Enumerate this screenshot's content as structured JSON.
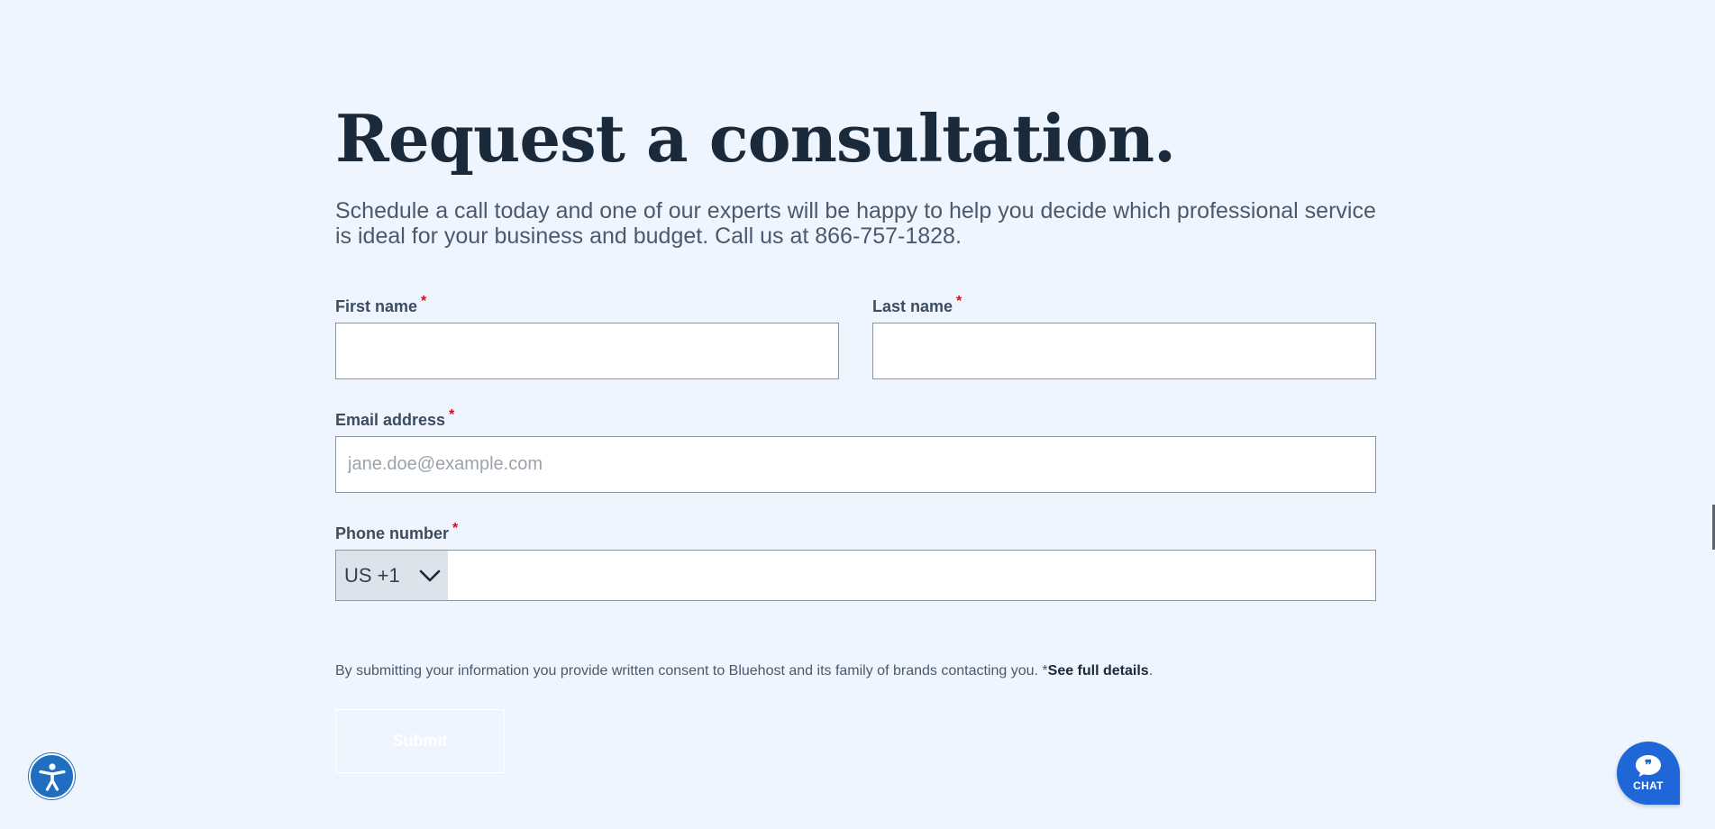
{
  "header": {
    "title": "Request a consultation.",
    "subtitle": "Schedule a call today and one of our experts will be happy to help you decide which professional service is ideal for your business and budget. Call us at 866-757-1828."
  },
  "form": {
    "first_name_label": "First name",
    "last_name_label": "Last name",
    "email_label": "Email address",
    "email_placeholder": "jane.doe@example.com",
    "phone_label": "Phone number",
    "country_code": "US +1",
    "required_marker": "*",
    "consent_text": "By submitting your information you provide written consent to Bluehost and its family of brands contacting you. *",
    "consent_link": "See full details",
    "consent_end": ".",
    "submit_label": "Submit"
  },
  "widgets": {
    "chat_label": "CHAT",
    "accessibility_icon": "accessibility-icon",
    "chat_icon": "chat-bubble-icon"
  },
  "colors": {
    "background": "#eef5ff",
    "heading": "#1b2a3b",
    "required": "#c4161c",
    "accent": "#1f67d9"
  }
}
